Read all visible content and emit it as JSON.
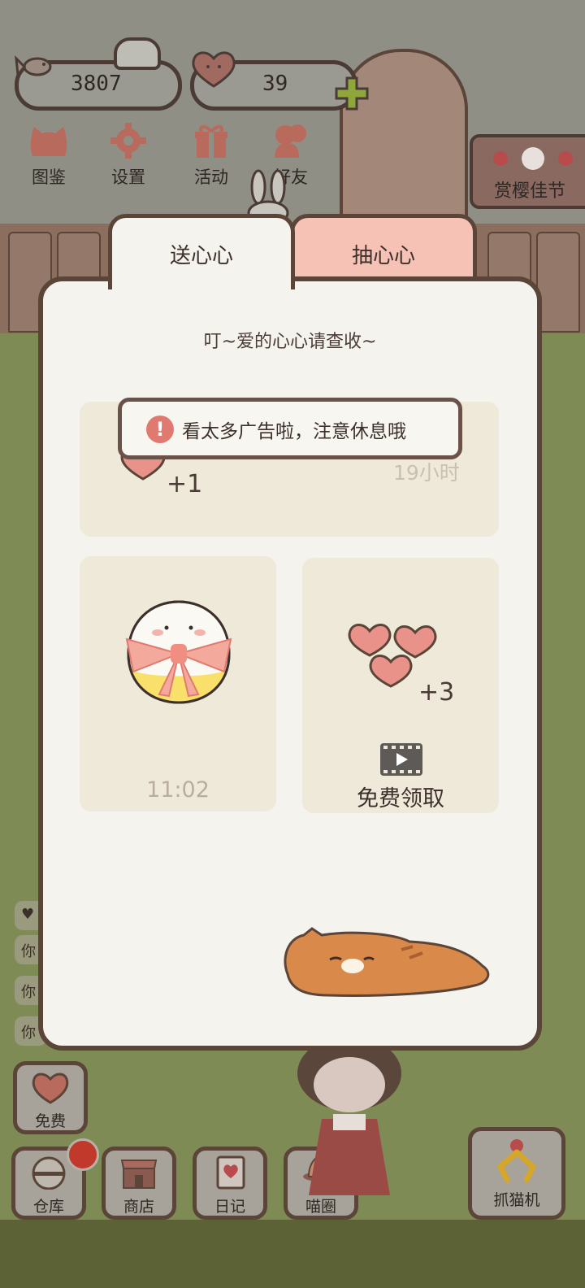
{
  "currencies": {
    "fish_value": "3807",
    "heart_value": "39"
  },
  "top_nav": [
    {
      "label": "图鉴",
      "icon": "cat-face-icon"
    },
    {
      "label": "设置",
      "icon": "gear-icon"
    },
    {
      "label": "活动",
      "icon": "gift-icon"
    },
    {
      "label": "好友",
      "icon": "friends-icon"
    }
  ],
  "festival": {
    "label": "赏樱佳节",
    "icon": "cherry-blossom-icon"
  },
  "tabs": {
    "send": "送心心",
    "draw": "抽心心"
  },
  "panel": {
    "title": "叮~爱的心心请查收~",
    "toast": "看太多广告啦，注意休息哦",
    "top_card": {
      "reward": "+1",
      "timer": "19小时"
    },
    "left_card": {
      "timer": "11:02"
    },
    "right_card": {
      "reward": "+3",
      "action": "免费领取"
    }
  },
  "chat_chips": [
    "你",
    "你",
    "你"
  ],
  "free_button": {
    "label": "免费"
  },
  "bottom_bar": [
    {
      "label": "仓库",
      "icon": "warehouse-icon"
    },
    {
      "label": "商店",
      "icon": "shop-icon"
    },
    {
      "label": "日记",
      "icon": "diary-icon"
    },
    {
      "label": "喵圈",
      "icon": "cat-planet-icon"
    }
  ],
  "claw_machine": {
    "label": "抓猫机",
    "icon": "claw-icon"
  },
  "colors": {
    "panel_bg": "#f5f3ee",
    "tab_inactive": "#f7c2b6",
    "card_bg": "#efe9da",
    "border": "#5a4538",
    "heart": "#e07a70"
  }
}
